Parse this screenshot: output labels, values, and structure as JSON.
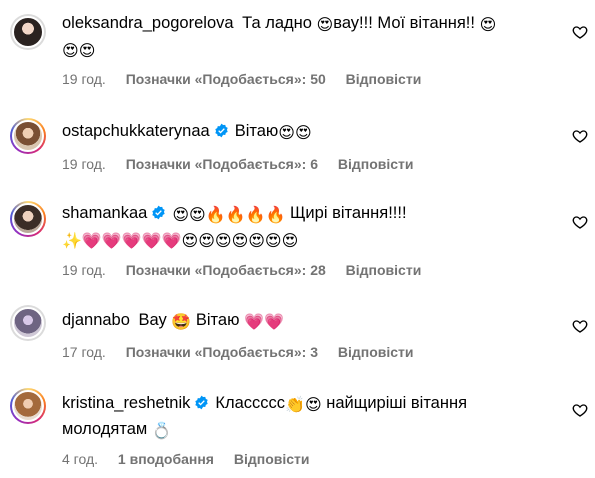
{
  "colors": {
    "meta": "#737373",
    "verified": "#0095f6"
  },
  "comments": [
    {
      "username": "oleksandra_pogorelova",
      "text_parts": [
        "Та ладно ",
        "😍",
        "вау!!! Мої вітання!! ",
        "😍",
        "😍",
        "😍"
      ],
      "time": "19 год.",
      "likes": "Позначки «Подобається»: 50",
      "reply": "Відповісти"
    },
    {
      "username": "ostapchukkaterynaa",
      "verified": true,
      "text_parts": [
        "Вітаю",
        "😍",
        "😍"
      ],
      "time": "19 год.",
      "likes": "Позначки «Подобається»: 6",
      "reply": "Відповісти"
    },
    {
      "username": "shamankaa",
      "verified": true,
      "text_parts": [
        "😍😍🔥🔥🔥🔥",
        "Щирі вітання!!!!",
        "✨💗💗💗💗💗😍😍😍😍😍😍😍"
      ],
      "time": "19 год.",
      "likes": "Позначки «Подобається»: 28",
      "reply": "Відповісти"
    },
    {
      "username": "djannabo",
      "text_parts": [
        "Вау ",
        "🤩",
        " Вітаю ",
        "💗💗"
      ],
      "time": "17 год.",
      "likes": "Позначки «Подобається»: 3",
      "reply": "Відповісти"
    },
    {
      "username": "kristina_reshetnik",
      "verified": true,
      "text_parts": [
        "Классссс",
        "👏😍",
        " найщиріші вітання молодятам ",
        "💍"
      ],
      "time": "4 год.",
      "likes": "1 вподобання",
      "reply": "Відповісти"
    }
  ],
  "icons": {
    "like": "heart-outline-icon",
    "verified": "verified-badge-icon"
  }
}
